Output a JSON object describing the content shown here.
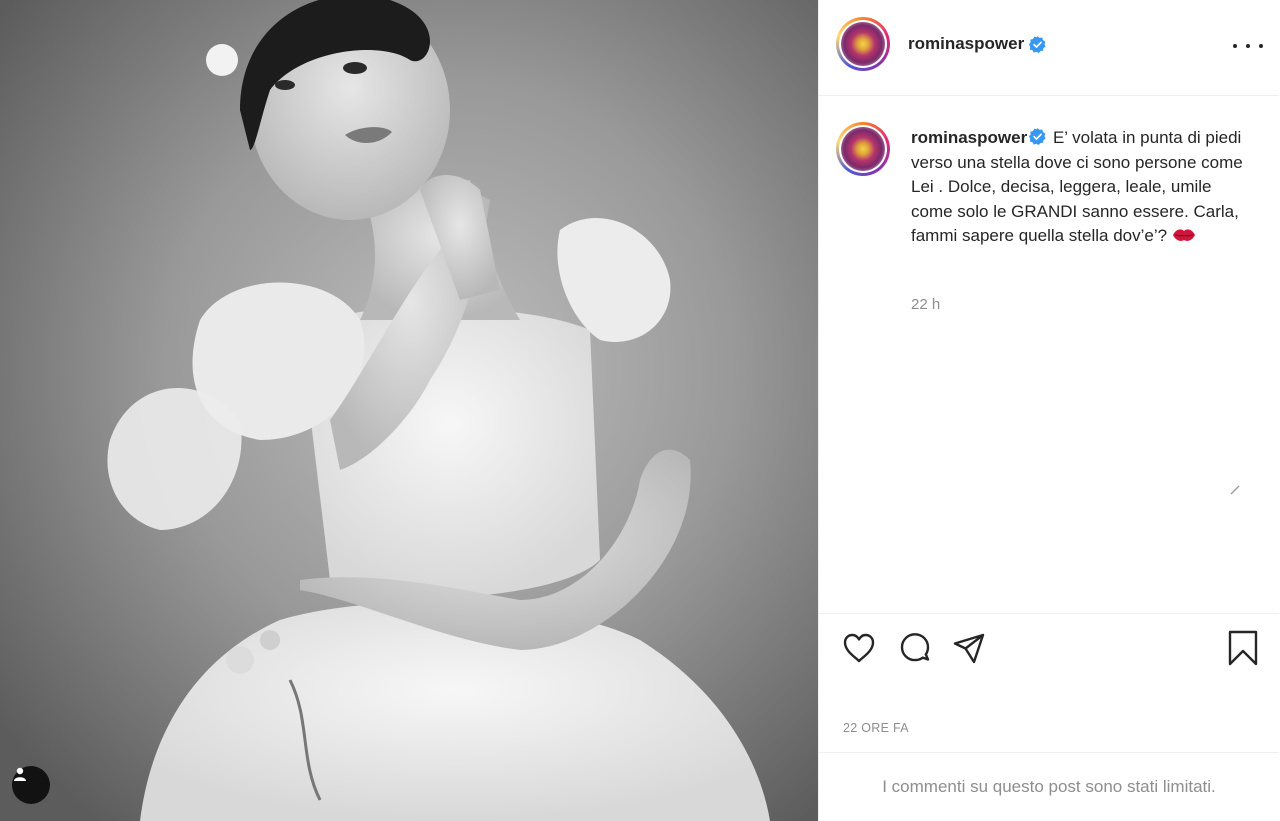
{
  "post": {
    "author": {
      "username": "rominaspower",
      "verified": true
    },
    "photo": {
      "description_icon": "user-tag-icon"
    },
    "caption": {
      "username": "rominaspower",
      "text": "E’ volata in punta di piedi verso una stella dove ci sono persone come Lei . Dolce, decisa, leggera, leale, umile come solo le GRANDI sanno essere. Carla, fammi sapere quella stella dov’e’?",
      "emoji": "lips-emoji",
      "time": "22 h"
    },
    "actions": {
      "like_icon": "heart-icon",
      "comment_icon": "comment-icon",
      "share_icon": "paper-plane-icon",
      "save_icon": "bookmark-icon"
    },
    "posted_ago": "22 ORE FA",
    "comments_notice": "I commenti su questo post sono stati limitati."
  },
  "colors": {
    "text": "#262626",
    "muted": "#8e8e8e",
    "verified": "#3897f0",
    "divider": "#efefef"
  }
}
